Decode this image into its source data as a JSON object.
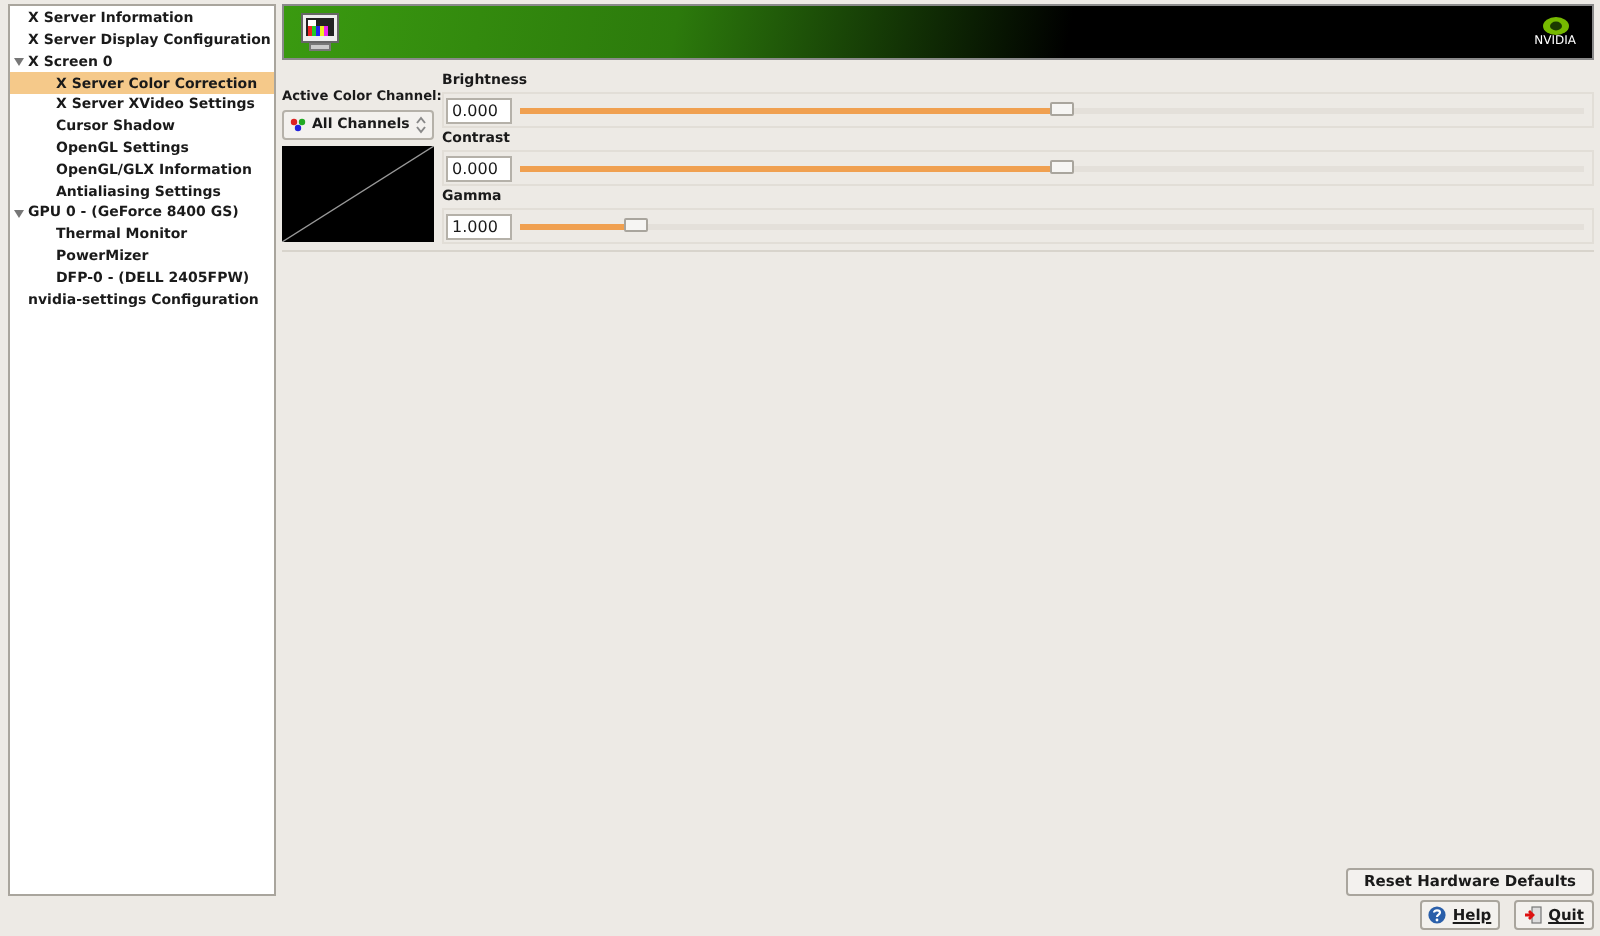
{
  "sidebar": {
    "items": [
      {
        "label": "X Server Information",
        "selected": false
      },
      {
        "label": "X Server Display Configuration",
        "selected": false
      },
      {
        "label": "X Screen 0",
        "selected": false,
        "expanded": true,
        "children": [
          {
            "label": "X Server Color Correction",
            "selected": true
          },
          {
            "label": "X Server XVideo Settings",
            "selected": false
          },
          {
            "label": "Cursor Shadow",
            "selected": false
          },
          {
            "label": "OpenGL Settings",
            "selected": false
          },
          {
            "label": "OpenGL/GLX Information",
            "selected": false
          },
          {
            "label": "Antialiasing Settings",
            "selected": false
          }
        ]
      },
      {
        "label": "GPU 0 - (GeForce 8400 GS)",
        "selected": false,
        "expanded": true,
        "children": [
          {
            "label": "Thermal Monitor",
            "selected": false
          },
          {
            "label": "PowerMizer",
            "selected": false
          },
          {
            "label": "DFP-0 - (DELL 2405FPW)",
            "selected": false
          }
        ]
      },
      {
        "label": "nvidia-settings Configuration",
        "selected": false
      }
    ]
  },
  "banner": {
    "logo_text": "NVIDIA"
  },
  "channel": {
    "label": "Active Color Channel:",
    "value": "All Channels"
  },
  "controls": [
    {
      "label": "Brightness",
      "value": "0.000",
      "level": 0.5
    },
    {
      "label": "Contrast",
      "value": "0.000",
      "level": 0.5
    },
    {
      "label": "Gamma",
      "value": "1.000",
      "level": 0.1
    }
  ],
  "buttons": {
    "reset": "Reset Hardware Defaults",
    "help": "Help",
    "quit": "Quit"
  }
}
